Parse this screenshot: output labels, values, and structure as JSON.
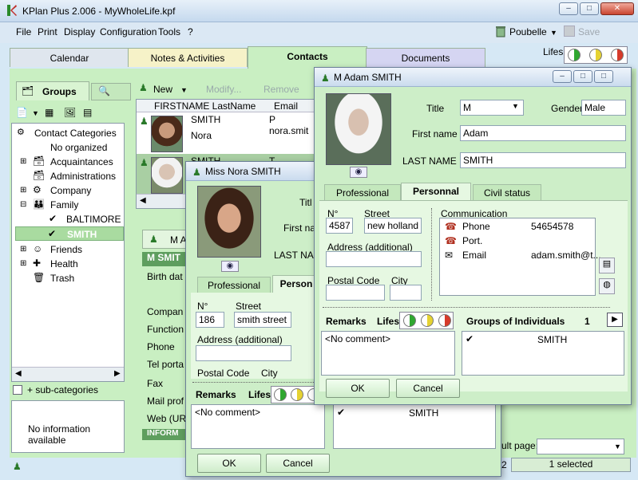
{
  "app": {
    "title": "KPlan Plus 2.006 - MyWholeLife.kpf",
    "window_controls": [
      "–",
      "□",
      "✕"
    ]
  },
  "menu": {
    "items": [
      "File",
      "Print",
      "Display",
      "Configuration",
      "Tools",
      "?"
    ],
    "poubelle": "Poubelle",
    "save": "Save",
    "lifes": "Lifes"
  },
  "tabs": {
    "calendar": "Calendar",
    "notes": "Notes & Activities",
    "contacts": "Contacts",
    "documents": "Documents"
  },
  "left": {
    "groups_tab": "Groups",
    "tree_root": "Contact Categories",
    "items": [
      "No organized",
      "Acquaintances",
      "Administrations",
      "Company",
      "Family",
      "BALTIMORE",
      "SMITH",
      "Friends",
      "Health",
      "Trash"
    ],
    "subcat": "+ sub-categories",
    "no_info": "No information available"
  },
  "list": {
    "new": "New",
    "modify": "Modify...",
    "remove": "Remove",
    "col_name": "FIRSTNAME LastName",
    "col_email": "Email",
    "rows": [
      {
        "last": "SMITH",
        "first": "Nora",
        "email": "P nora.smit"
      },
      {
        "last": "SMITH",
        "first": "",
        "email": "T adam.sm"
      }
    ]
  },
  "detail": {
    "header": "M A",
    "name_bar": "M SMIT",
    "fields": [
      "Birth dat",
      "Compan",
      "Function",
      "Phone",
      "Tel porta",
      "Fax",
      "Mail prof",
      "Web (UR",
      "INFORM"
    ]
  },
  "status": {
    "page_num": "2",
    "selected": "1 selected",
    "result_page": "ult page:"
  },
  "nora": {
    "title": "Miss Nora SMITH",
    "title_lbl": "Titl",
    "first_lbl": "First nar",
    "last_lbl": "LAST NAM",
    "tabs": [
      "Professional",
      "Person"
    ],
    "n_lbl": "N°",
    "street_lbl": "Street",
    "n_val": "186",
    "street_val": "smith street",
    "addr_lbl": "Address (additional)",
    "postal_lbl": "Postal Code",
    "city_lbl": "City",
    "remarks": "Remarks",
    "lifes": "Lifes",
    "comment": "<No comment>",
    "group_name": "SMITH",
    "ok": "OK",
    "cancel": "Cancel"
  },
  "adam": {
    "title": "M Adam SMITH",
    "title_lbl": "Title",
    "title_val": "M",
    "gender_lbl": "Gender",
    "gender_val": "Male",
    "first_lbl": "First name",
    "first_val": "Adam",
    "last_lbl": "LAST NAME",
    "last_val": "SMITH",
    "tabs": [
      "Professional",
      "Personnal",
      "Civil status"
    ],
    "n_lbl": "N°",
    "street_lbl": "Street",
    "n_val": "4587",
    "street_val": "new holland ro",
    "addr_lbl": "Address (additional)",
    "postal_lbl": "Postal Code",
    "city_lbl": "City",
    "comm_lbl": "Communication",
    "comm": [
      {
        "type": "Phone",
        "value": "54654578"
      },
      {
        "type": "Port.",
        "value": ""
      },
      {
        "type": "Email",
        "value": "adam.smith@t..."
      }
    ],
    "remarks": "Remarks",
    "lifes": "Lifes",
    "groups_lbl": "Groups of Individuals",
    "groups_count": "1",
    "comment": "<No comment>",
    "group_name": "SMITH",
    "ok": "OK",
    "cancel": "Cancel"
  }
}
